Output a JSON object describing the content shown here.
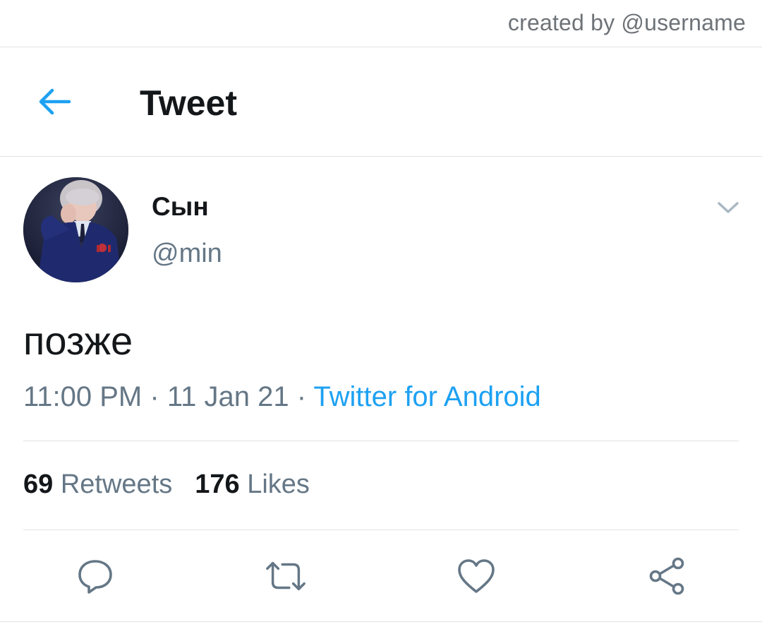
{
  "credit": {
    "text": "created by @username"
  },
  "header": {
    "title": "Tweet",
    "back_icon": "arrow-left-icon"
  },
  "tweet": {
    "author": {
      "display_name": "Сын",
      "handle": "@min",
      "avatar_icon": "avatar-photo"
    },
    "text": "позже",
    "time": "11:00 PM",
    "separator": "·",
    "date": "11 Jan 21",
    "source": "Twitter for Android",
    "caret_icon": "chevron-down-icon"
  },
  "stats": {
    "retweets_count": "69",
    "retweets_label": "Retweets",
    "likes_count": "176",
    "likes_label": "Likes"
  },
  "actions": [
    {
      "name": "reply",
      "icon": "reply-icon"
    },
    {
      "name": "retweet",
      "icon": "retweet-icon"
    },
    {
      "name": "like",
      "icon": "heart-icon"
    },
    {
      "name": "share",
      "icon": "share-icon"
    }
  ],
  "colors": {
    "accent": "#1da1f2",
    "text_primary": "#14171a",
    "text_secondary": "#657786",
    "divider": "#e1e3e6"
  }
}
